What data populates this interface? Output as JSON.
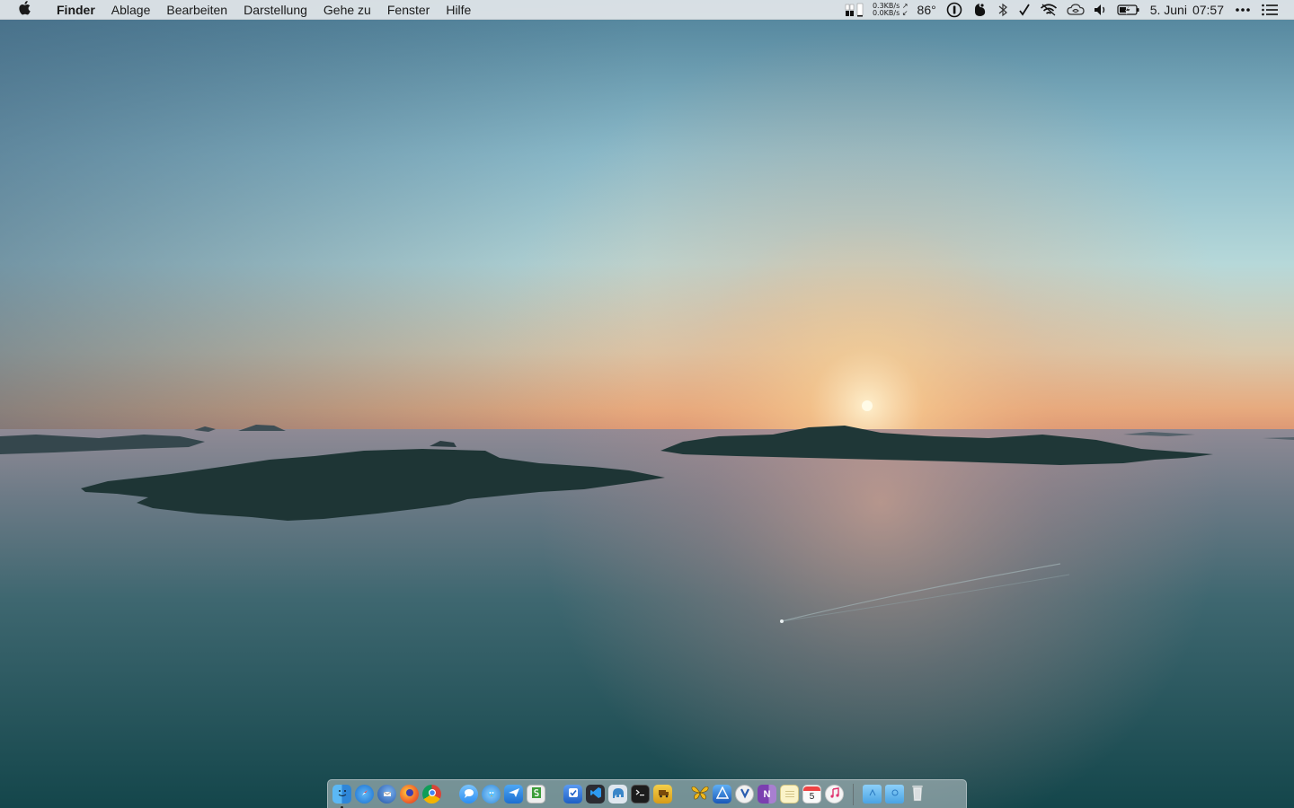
{
  "menubar": {
    "apple_icon": "apple-logo-icon",
    "app_name": "Finder",
    "menus": [
      "Ablage",
      "Bearbeiten",
      "Darstellung",
      "Gehe zu",
      "Fenster",
      "Hilfe"
    ],
    "status": {
      "net_up": "0.3KB/s ↗",
      "net_down": "0.0KB/s ↙",
      "temperature": "86°",
      "date": "5. Juni",
      "time": "07:57",
      "icons": [
        "memory-bars-icon",
        "onepassword-icon",
        "dropzone-icon",
        "bluetooth-icon",
        "checkmark-icon",
        "wifi-icon",
        "creative-cloud-icon",
        "volume-icon",
        "battery-charging-icon",
        "more-icon",
        "notification-center-icon"
      ]
    }
  },
  "dock": {
    "apps": [
      {
        "name": "finder",
        "color": "#3aa0f0",
        "running": true
      },
      {
        "name": "safari",
        "color": "#1e88e5"
      },
      {
        "name": "thunderbird",
        "color": "#1f5fbf"
      },
      {
        "name": "firefox",
        "color": "#f37121"
      },
      {
        "name": "chrome",
        "color": "#e6e6e6"
      },
      {
        "name": "messages",
        "color": "#5ab0f7"
      },
      {
        "name": "tweetbot",
        "color": "#4aa3df"
      },
      {
        "name": "airmail",
        "color": "#2f8ee8"
      },
      {
        "name": "scrivener",
        "color": "#ececec"
      },
      {
        "name": "things",
        "color": "#2c6fdc"
      },
      {
        "name": "visual-studio-code",
        "color": "#2b6cb0"
      },
      {
        "name": "sequel-pro",
        "color": "#3a86c8"
      },
      {
        "name": "terminal",
        "color": "#222222"
      },
      {
        "name": "transmit",
        "color": "#e7b52a"
      },
      {
        "name": "tes",
        "color": "#e4bb2c"
      },
      {
        "name": "affinity-designer",
        "color": "#2a70c9"
      },
      {
        "name": "vivaldi",
        "color": "#e9e9e9"
      },
      {
        "name": "onenote",
        "color": "#7b3fb0"
      },
      {
        "name": "notes",
        "color": "#f2e6a8"
      },
      {
        "name": "calendar",
        "color": "#f5f5f5"
      },
      {
        "name": "itunes",
        "color": "#e9e9e9"
      }
    ],
    "separators_after": [
      4,
      8,
      14
    ],
    "stacks": [
      {
        "name": "applications-folder",
        "color": "#63b4e8"
      },
      {
        "name": "downloads-folder",
        "color": "#63b4e8"
      },
      {
        "name": "trash",
        "color": "#d8dde0"
      }
    ],
    "calendar_day": "5",
    "onenote_letter": "N"
  },
  "colors": {
    "sky_top": "#5d8ea6",
    "sky_mid": "#a9cfd8",
    "horizon": "#e9b989",
    "sun": "#fffbe7",
    "sea_near": "#1b5a5e",
    "island": "#1e3737"
  }
}
